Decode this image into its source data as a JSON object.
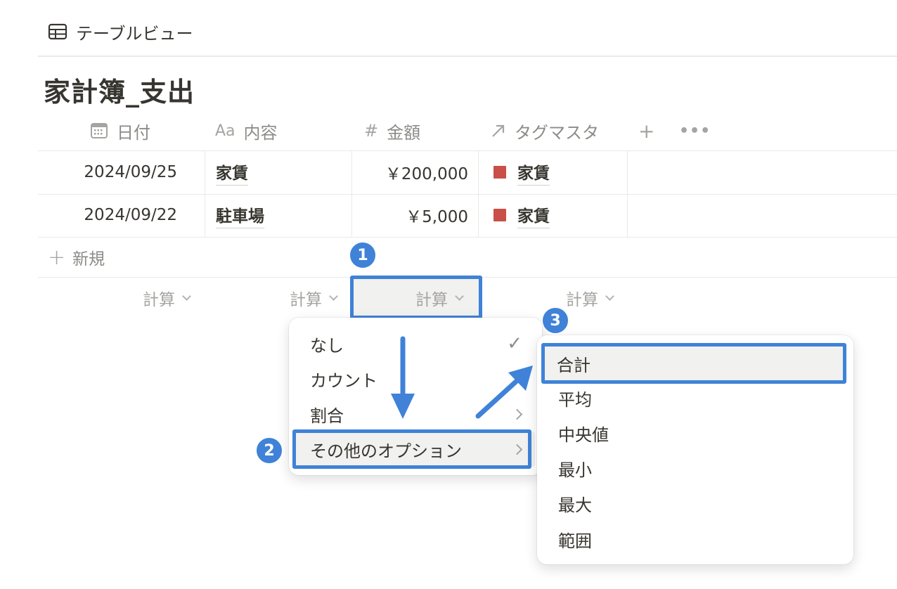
{
  "view": {
    "tab_label": "テーブルビュー",
    "tab_icon": "table-icon"
  },
  "page": {
    "title": "家計簿_支出"
  },
  "columns": [
    {
      "label": "日付",
      "icon": "calendar-icon"
    },
    {
      "label": "内容",
      "icon_text": "Aa"
    },
    {
      "label": "金額",
      "icon_text": "#"
    },
    {
      "label": "タグマスタ",
      "icon": "relation-arrow-icon"
    }
  ],
  "header_actions": {
    "add": "+",
    "more": "•••"
  },
  "rows": [
    {
      "date": "2024/09/25",
      "content": "家賃",
      "amount": "￥200,000",
      "tag": "家賃"
    },
    {
      "date": "2024/09/22",
      "content": "駐車場",
      "amount": "￥5,000",
      "tag": "家賃"
    }
  ],
  "new_row_label": "新規",
  "calc_label": "計算",
  "badges": [
    "1",
    "2",
    "3"
  ],
  "calc_menu": {
    "items": [
      {
        "label": "なし",
        "check": "✓"
      },
      {
        "label": "カウント"
      },
      {
        "label": "割合"
      },
      {
        "label": "その他のオプション"
      }
    ]
  },
  "submenu": {
    "items": [
      "合計",
      "平均",
      "中央値",
      "最小",
      "最大",
      "範囲"
    ]
  },
  "colors": {
    "accent": "#3f82d8",
    "tag_swatch": "#c94f48",
    "menu_hover": "#f1f1ef"
  }
}
